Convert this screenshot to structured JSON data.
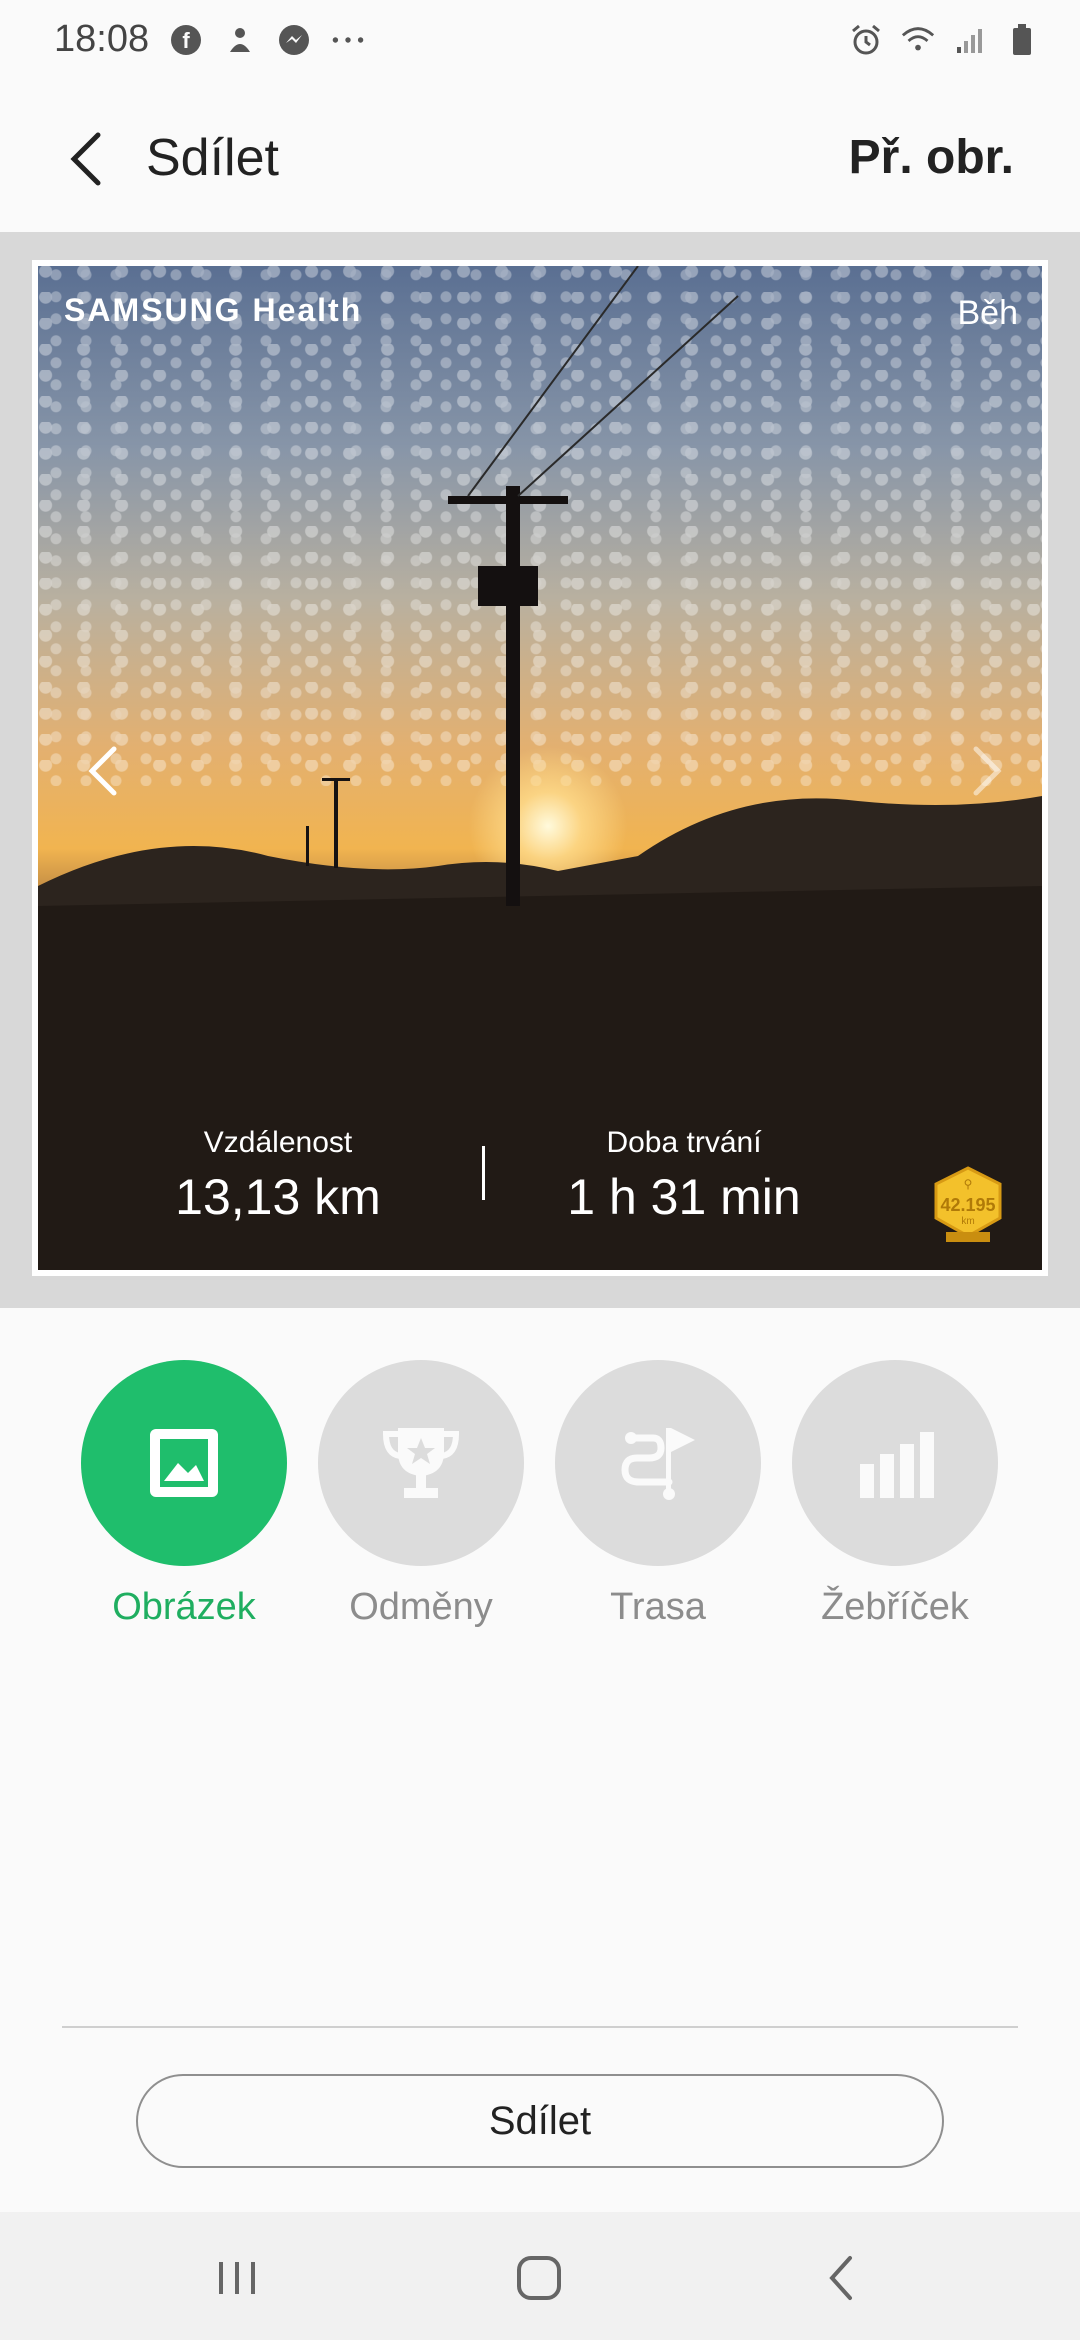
{
  "status_bar": {
    "time": "18:08",
    "left_icons": [
      "facebook-icon",
      "app-icon",
      "messenger-icon",
      "more-dots-icon"
    ],
    "right_icons": [
      "alarm-icon",
      "wifi-icon",
      "signal-icon",
      "battery-icon"
    ]
  },
  "header": {
    "title": "Sdílet",
    "action": "Př. obr."
  },
  "preview": {
    "brand": "SAMSUNG Health",
    "activity": "Běh",
    "stats": {
      "distance_label": "Vzdálenost",
      "distance_value": "13,13 km",
      "duration_label": "Doba trvání",
      "duration_value": "1 h 31 min"
    },
    "medal": {
      "value": "42.195",
      "unit": "km"
    }
  },
  "options": [
    {
      "label": "Obrázek",
      "icon": "image-icon",
      "active": true
    },
    {
      "label": "Odměny",
      "icon": "trophy-icon",
      "active": false
    },
    {
      "label": "Trasa",
      "icon": "route-icon",
      "active": false
    },
    {
      "label": "Žebříček",
      "icon": "leaderboard-icon",
      "active": false
    }
  ],
  "share_button": "Sdílet",
  "colors": {
    "accent": "#1fbe6c",
    "inactive": "#dcdcdc"
  }
}
